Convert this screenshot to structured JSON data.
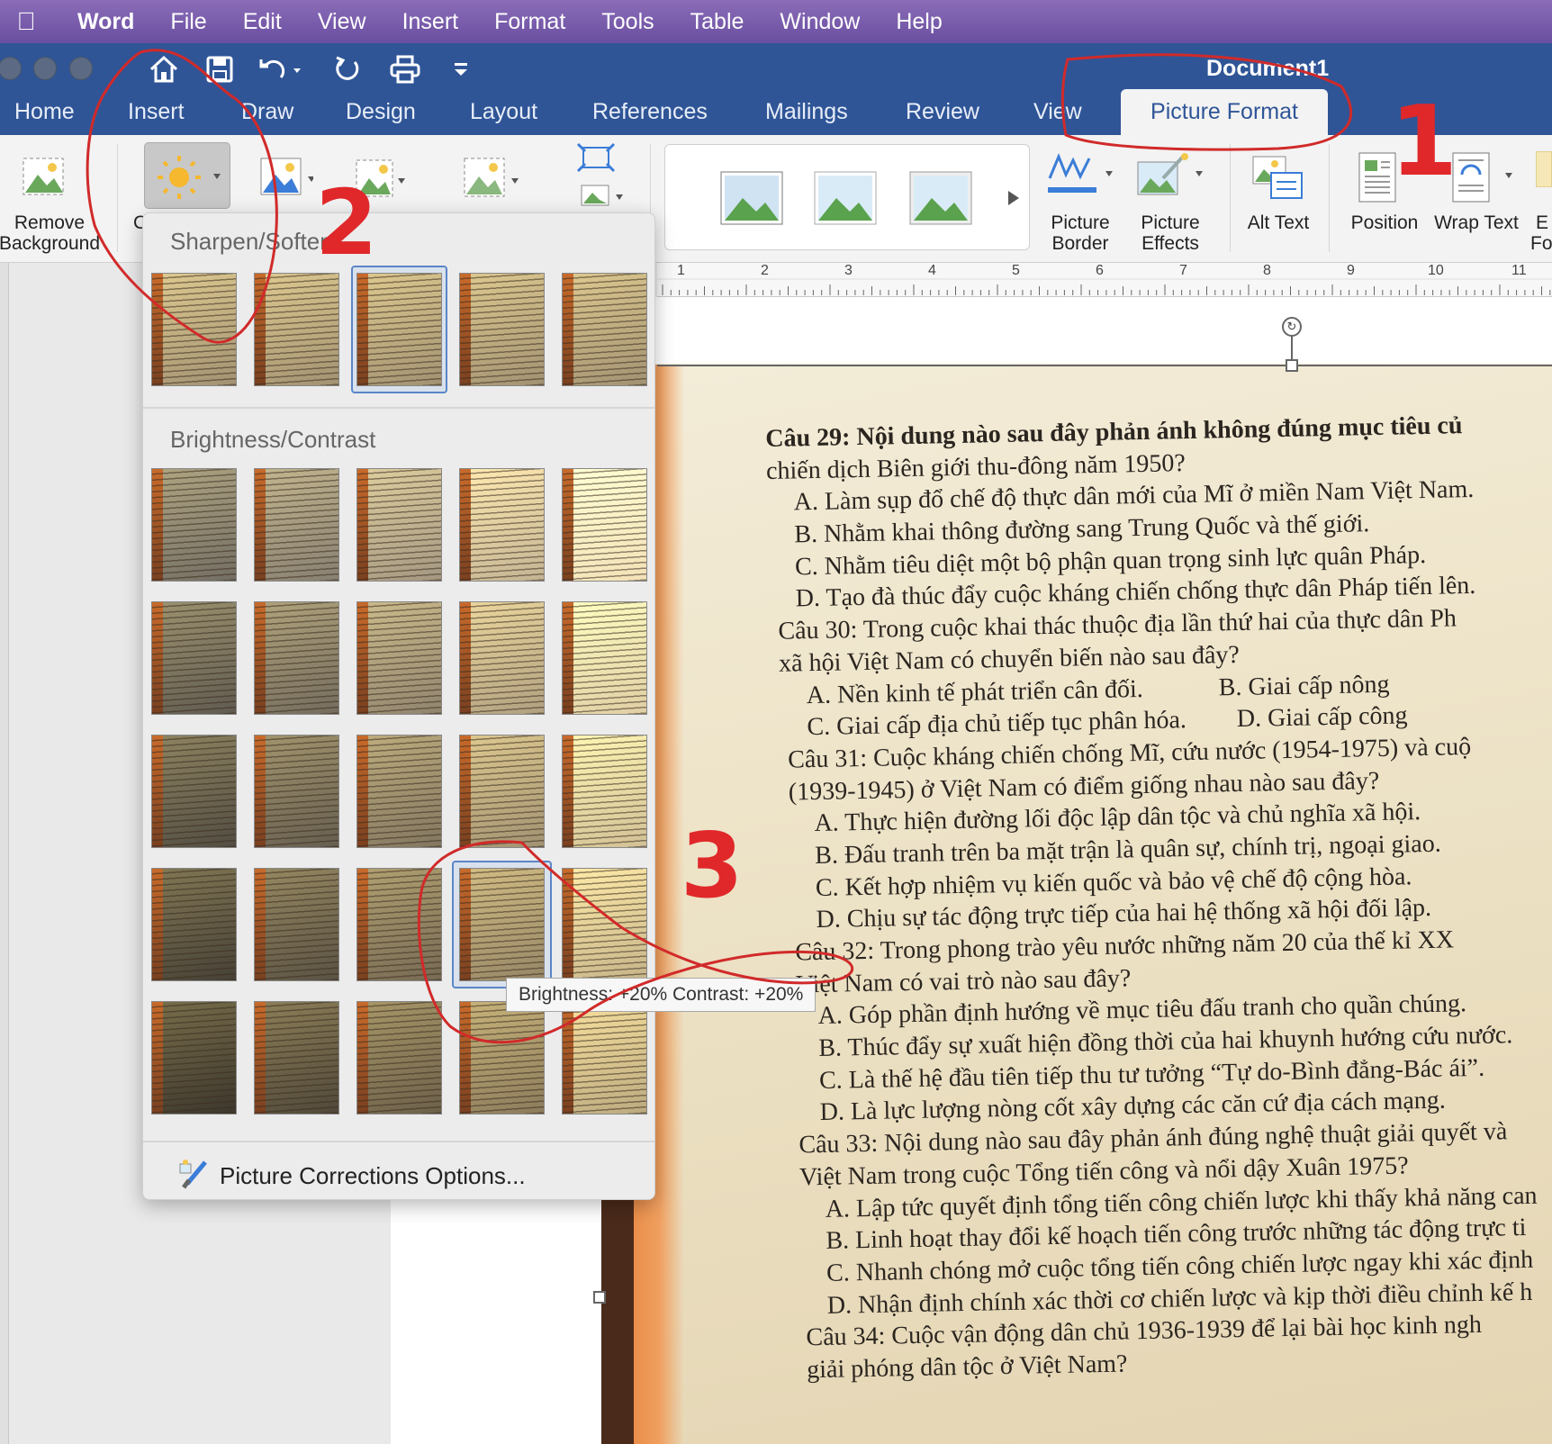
{
  "menubar": {
    "app_name": "Word",
    "items": [
      "File",
      "Edit",
      "View",
      "Insert",
      "Format",
      "Tools",
      "Table",
      "Window",
      "Help"
    ]
  },
  "window": {
    "title": "Document1"
  },
  "tabs": [
    "Home",
    "Insert",
    "Draw",
    "Design",
    "Layout",
    "References",
    "Mailings",
    "Review",
    "View"
  ],
  "active_tab": "Picture Format",
  "ribbon": {
    "remove_background": "Remove Background",
    "corrections_partial": "C",
    "picture_border": "Picture Border",
    "picture_effects": "Picture Effects",
    "alt_text": "Alt Text",
    "position": "Position",
    "wrap_text": "Wrap Text",
    "cut_off_label": "E",
    "cut_off_label2": "Fo"
  },
  "ruler": [
    "1",
    "2",
    "3",
    "4",
    "5",
    "6",
    "7",
    "8",
    "9",
    "10",
    "11"
  ],
  "corrections_menu": {
    "sharpen_heading": "Sharpen/Soften",
    "brightness_heading": "Brightness/Contrast",
    "tooltip": "Brightness: +20% Contrast: +20%",
    "options_label": "Picture Corrections Options..."
  },
  "annotations": {
    "n1": "1",
    "n2": "2",
    "n3": "3"
  },
  "colors": {
    "title_blue": "#2f5597",
    "menubar_purple": "#7b5fae",
    "annotation_red": "#e0282a"
  },
  "document_text": [
    "Câu 29: Nội dung nào sau đây phản ánh không đúng mục tiêu củ",
    "chiến dịch Biên giới thu-đông năm 1950?",
    "A. Làm sụp đổ chế độ thực dân mới của Mĩ ở miền Nam Việt Nam.",
    "B. Nhằm khai thông đường sang Trung Quốc và thế giới.",
    "C. Nhằm tiêu diệt một bộ phận quan trọng sinh lực quân Pháp.",
    "D. Tạo đà thúc đẩy cuộc kháng chiến chống thực dân Pháp tiến lên.",
    "Câu 30: Trong cuộc khai thác thuộc địa lần thứ hai của thực dân Ph",
    "xã hội Việt Nam có chuyển biến nào sau đây?",
    "A. Nền kinh tế phát triển cân đối.            B. Giai cấp nông",
    "C. Giai cấp địa chủ tiếp tục phân hóa.        D. Giai cấp công",
    "Câu 31: Cuộc kháng chiến chống Mĩ, cứu nước (1954-1975) và cuộ",
    "(1939-1945) ở Việt Nam có điểm giống nhau nào sau đây?",
    "A. Thực hiện đường lối độc lập dân tộc và chủ nghĩa xã hội.",
    "B. Đấu tranh trên ba mặt trận là quân sự, chính trị, ngoại giao.",
    "C. Kết hợp nhiệm vụ kiến quốc và bảo vệ chế độ cộng hòa.",
    "D. Chịu sự tác động trực tiếp của hai hệ thống xã hội đối lập.",
    "Câu 32: Trong phong trào yêu nước những năm 20 của thế kỉ XX",
    "Việt Nam có vai trò nào sau đây?",
    "A. Góp phần định hướng về mục tiêu đấu tranh cho quần chúng.",
    "B. Thúc đẩy sự xuất hiện đồng thời của hai khuynh hướng cứu nước.",
    "C. Là thế hệ đầu tiên tiếp thu tư tưởng “Tự do-Bình đẳng-Bác ái”.",
    "D. Là lực lượng nòng cốt xây dựng các căn cứ địa cách mạng.",
    "Câu 33: Nội dung nào sau đây phản ánh đúng nghệ thuật giải quyết và",
    "Việt Nam trong cuộc Tổng tiến công và nổi dậy Xuân 1975?",
    "A. Lập tức quyết định tổng tiến công chiến lược khi thấy khả năng can",
    "B. Linh hoạt thay đổi kế hoạch tiến công trước những tác động trực ti",
    "C. Nhanh chóng mở cuộc tổng tiến công chiến lược ngay khi xác định",
    "D. Nhận định chính xác thời cơ chiến lược và kịp thời điều chỉnh kế h",
    "Câu 34: Cuộc vận động dân chủ 1936-1939 để lại bài học kinh ngh",
    "giải phóng dân tộc ở Việt Nam?"
  ]
}
